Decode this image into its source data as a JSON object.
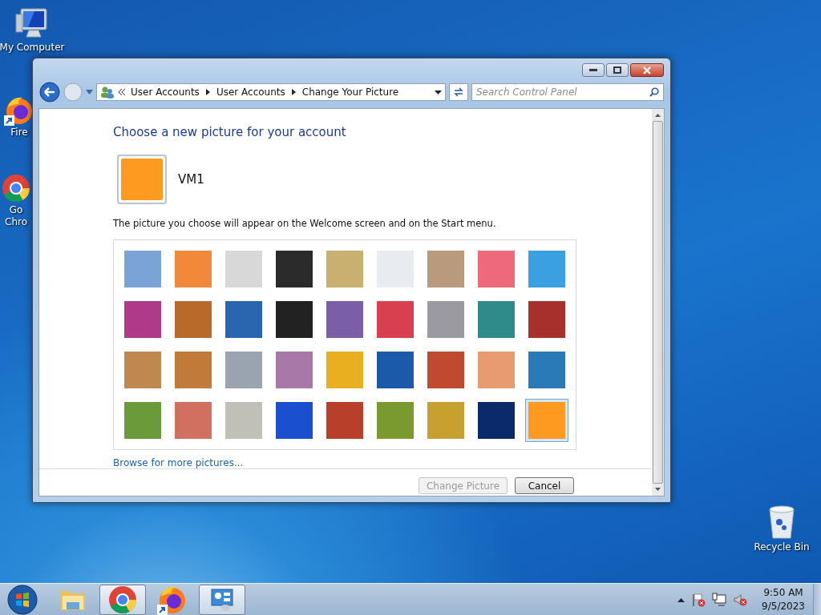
{
  "desktop": {
    "icons": [
      {
        "kind": "computer",
        "label_lines": [
          "My Computer"
        ]
      },
      {
        "kind": "firefox",
        "label_lines": [
          "Fire"
        ]
      },
      {
        "kind": "chrome",
        "label_lines": [
          "Go",
          "Chro"
        ]
      },
      {
        "kind": "recycle",
        "label_lines": [
          "Recycle Bin"
        ]
      }
    ]
  },
  "window": {
    "address": {
      "segments": [
        "User Accounts",
        "User Accounts",
        "Change Your Picture"
      ]
    },
    "search": {
      "placeholder": "Search Control Panel"
    },
    "heading": "Choose a new picture for your account",
    "account": {
      "name": "VM1"
    },
    "description": "The picture you choose will appear on the Welcome screen and on the Start menu.",
    "pictures": [
      {
        "selected": false
      },
      {
        "selected": false
      },
      {
        "selected": false
      },
      {
        "selected": false
      },
      {
        "selected": false
      },
      {
        "selected": false
      },
      {
        "selected": false
      },
      {
        "selected": false
      },
      {
        "selected": false
      },
      {
        "selected": false
      },
      {
        "selected": false
      },
      {
        "selected": false
      },
      {
        "selected": false
      },
      {
        "selected": false
      },
      {
        "selected": false
      },
      {
        "selected": false
      },
      {
        "selected": false
      },
      {
        "selected": false
      },
      {
        "selected": false
      },
      {
        "selected": false
      },
      {
        "selected": false
      },
      {
        "selected": false
      },
      {
        "selected": false
      },
      {
        "selected": false
      },
      {
        "selected": false
      },
      {
        "selected": false
      },
      {
        "selected": false
      },
      {
        "selected": false
      },
      {
        "selected": false
      },
      {
        "selected": false
      },
      {
        "selected": false
      },
      {
        "selected": false
      },
      {
        "selected": false
      },
      {
        "selected": false
      },
      {
        "selected": false
      },
      {
        "selected": true
      }
    ],
    "browse_link": "Browse for more pictures...",
    "buttons": [
      {
        "label": "Change Picture",
        "disabled": true
      },
      {
        "label": "Cancel",
        "disabled": false
      }
    ]
  },
  "taskbar": {
    "apps": [
      {
        "kind": "explorer",
        "active": false
      },
      {
        "kind": "chrome",
        "active": true
      },
      {
        "kind": "firefox",
        "active": false
      },
      {
        "kind": "control-panel",
        "active": true
      }
    ],
    "clock": {
      "time": "9:50 AM",
      "date": "9/5/2023"
    }
  }
}
